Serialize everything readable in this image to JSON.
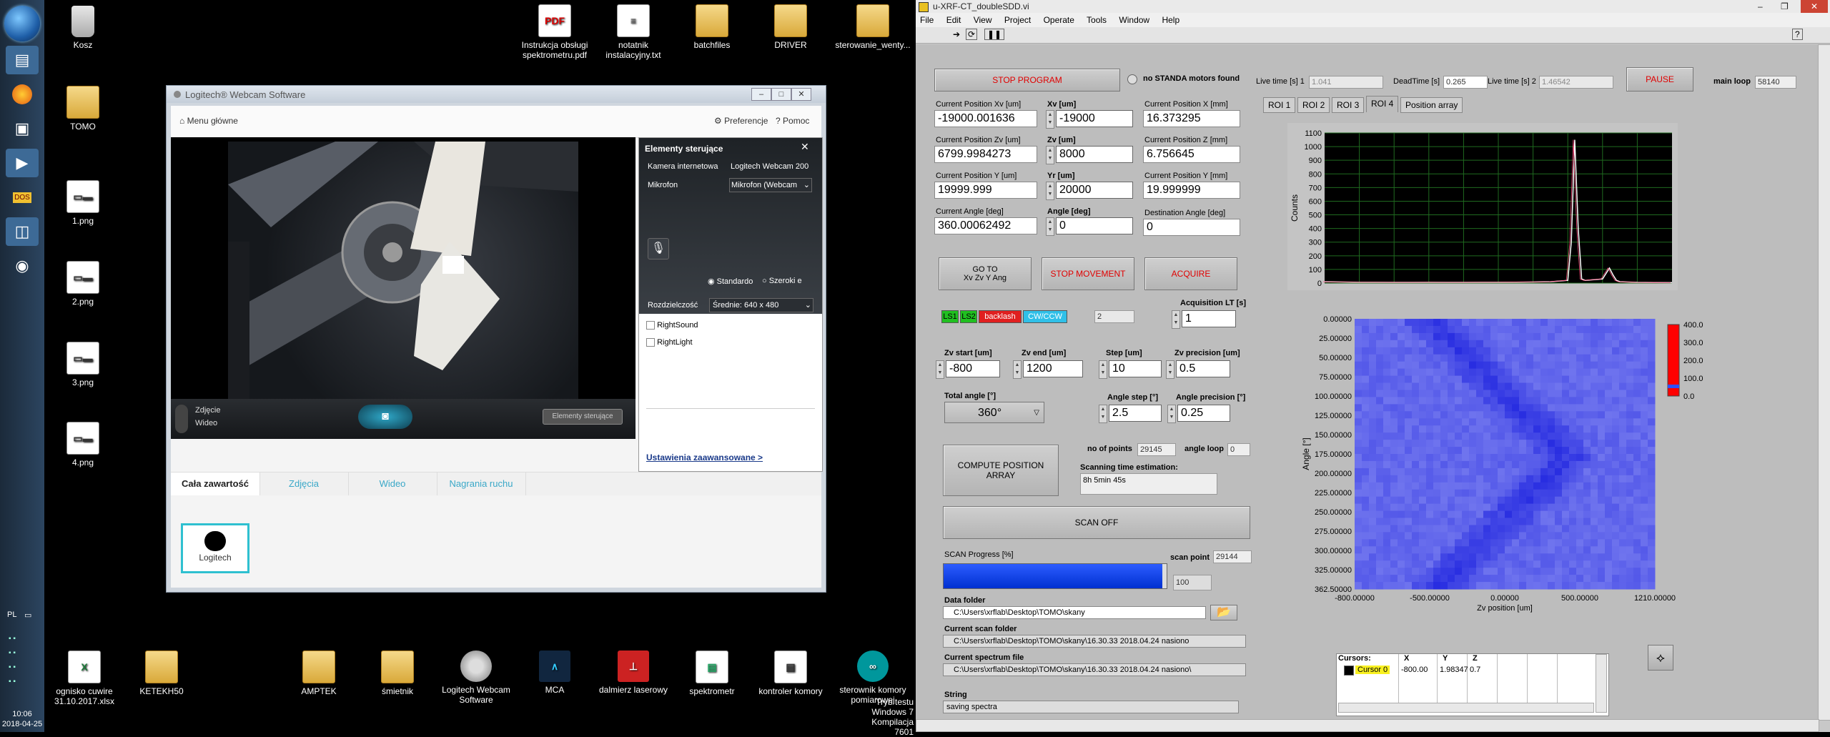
{
  "taskbar": {
    "lang": "PL",
    "time": "10:06",
    "date": "2018-04-25"
  },
  "desktop": {
    "icons_left": [
      {
        "label": "Kosz"
      },
      {
        "label": "TOMO"
      },
      {
        "label": "1.png"
      },
      {
        "label": "2.png"
      },
      {
        "label": "3.png"
      },
      {
        "label": "4.png"
      }
    ],
    "icons_top": [
      {
        "label": "Instrukcja obsługi spektrometru.pdf",
        "badge": "PDF"
      },
      {
        "label": "notatnik instalacyjny.txt"
      },
      {
        "label": "batchfiles"
      },
      {
        "label": "DRIVER"
      },
      {
        "label": "sterowanie_wenty..."
      }
    ],
    "icons_bottom": [
      {
        "label": "ognisko cuwire 31.10.2017.xlsx"
      },
      {
        "label": "KETEKH50"
      },
      {
        "label": "AMPTEK"
      },
      {
        "label": "śmietnik"
      },
      {
        "label": "Logitech Webcam Software"
      },
      {
        "label": "MCA"
      },
      {
        "label": "dalmierz laserowy"
      },
      {
        "label": "spektrometr"
      },
      {
        "label": "kontroler komory"
      },
      {
        "label": "sterownik komory pomiarowej"
      }
    ],
    "watermark": [
      "Tryb testu",
      "Windows 7",
      "Kompilacja 7601"
    ]
  },
  "logitech": {
    "title": "Logitech® Webcam Software",
    "nav_home": "Menu główne",
    "nav_prefs": "Preferencje",
    "nav_help": "Pomoc",
    "mode_photo": "Zdjęcie",
    "mode_video": "Wideo",
    "controls_button": "Elementy sterujące",
    "panel": {
      "title": "Elementy sterujące",
      "camera_label": "Kamera internetowa",
      "camera_value": "Logitech Webcam 200",
      "mic_label": "Mikrofon",
      "mic_value": "Mikrofon (Webcam",
      "radio_standard": "Standardo",
      "radio_wide": "Szeroki e",
      "res_label": "Rozdzielczość",
      "res_value": "Średnie: 640 x 480",
      "check1": "RightSound",
      "check2": "RightLight",
      "advanced": "Ustawienia zaawansowane >"
    },
    "tabs": [
      "Cała zawartość",
      "Zdjęcia",
      "Wideo",
      "Nagrania ruchu"
    ],
    "thumb_label": "Logitech"
  },
  "lv": {
    "title": "u-XRF-CT_doubleSDD.vi",
    "menu": [
      "File",
      "Edit",
      "View",
      "Project",
      "Operate",
      "Tools",
      "Window",
      "Help"
    ],
    "stop_program": "STOP PROGRAM",
    "no_standa": "no STANDA motors found",
    "live_time1_label": "Live time [s] 1",
    "live_time1": "1.041",
    "deadtime_label": "DeadTime [s]",
    "deadtime": "0.265",
    "live_time2_label": "Live time [s] 2",
    "live_time2": "1.46542",
    "pause": "PAUSE",
    "main_loop_label": "main loop",
    "main_loop": "58140",
    "tabs": [
      "ROI 1",
      "ROI 2",
      "ROI 3",
      "ROI 4",
      "Position array"
    ],
    "pos": {
      "cur_xv_label": "Current Position Xv [um]",
      "cur_xv": "-19000.001636",
      "xv_label": "Xv [um]",
      "xv": "-19000",
      "cur_x_label": "Current Position X [mm]",
      "cur_x": "16.373295",
      "cur_zv_label": "Current Position Zv [um]",
      "cur_zv": "6799.9984273",
      "zv_label": "Zv [um]",
      "zv": "8000",
      "cur_z_label": "Current Position Z [mm]",
      "cur_z": "6.756645",
      "cur_y_label": "Current Position Y [um]",
      "cur_y": "19999.999",
      "yr_label": "Yr [um]",
      "yr": "20000",
      "cur_ymm_label": "Current Position Y [mm]",
      "cur_ymm": "19.999999",
      "cur_angle_label": "Current Angle [deg]",
      "cur_angle": "360.00062492",
      "angle_label": "Angle [deg]",
      "angle": "0",
      "dest_angle_label": "Destination Angle [deg]",
      "dest_angle": "0"
    },
    "goto": "GO TO\nXv Zv Y Ang",
    "stop_movement": "STOP MOVEMENT",
    "acquire": "ACQUIRE",
    "ls1": "LS1",
    "ls2": "LS2",
    "backlash": "backlash",
    "cwccw": "CW/CCW",
    "small_val": "2",
    "acq_lt_label": "Acquisition LT [s]",
    "acq_lt": "1",
    "zv_start_label": "Zv start [um]",
    "zv_start": "-800",
    "zv_end_label": "Zv end [um]",
    "zv_end": "1200",
    "step_label": "Step [um]",
    "step": "10",
    "zv_prec_label": "Zv precision [um]",
    "zv_prec": "0.5",
    "total_angle_label": "Total angle [°]",
    "total_angle": "360°",
    "angle_step_label": "Angle step [°]",
    "angle_step": "2.5",
    "angle_prec_label": "Angle precision [°]",
    "angle_prec": "0.25",
    "no_points_label": "no of points",
    "no_points": "29145",
    "angle_loop_label": "angle loop",
    "angle_loop": "0",
    "compute": "COMPUTE POSITION\nARRAY",
    "scan_time_label": "Scanning time estimation:",
    "scan_time": "8h  5min  45s",
    "scan_off": "SCAN OFF",
    "scan_progress_label": "SCAN Progress [%]",
    "scan_point_label": "scan point",
    "scan_point": "29144",
    "progress_max": "100",
    "progress_fraction": 0.98,
    "data_folder_label": "Data folder",
    "data_folder": "C:\\Users\\xrflab\\Desktop\\TOMO\\skany",
    "scan_folder_label": "Current scan folder",
    "scan_folder": "C:\\Users\\xrflab\\Desktop\\TOMO\\skany\\16.30.33 2018.04.24 nasiono",
    "spectrum_file_label": "Current spectrum file",
    "spectrum_file": "C:\\Users\\xrflab\\Desktop\\TOMO\\skany\\16.30.33 2018.04.24 nasiono\\",
    "string_label": "String",
    "string_val": "saving spectra",
    "cursors": {
      "headers": [
        "Cursors:",
        "X",
        "Y",
        "Z"
      ],
      "row": [
        "Cursor 0",
        "-800.00",
        "1.98347",
        "0.7"
      ]
    },
    "colorbar_ticks": [
      "400.0",
      "300.0",
      "200.0",
      "100.0",
      "0.0"
    ]
  },
  "chart_data": [
    {
      "type": "line",
      "title": "",
      "xlabel": "",
      "ylabel": "Counts",
      "ylim": [
        0,
        1100
      ],
      "yticks": [
        "1100",
        "1000",
        "900",
        "800",
        "700",
        "600",
        "500",
        "400",
        "300",
        "200",
        "100",
        "0"
      ],
      "x": [
        0,
        0.05,
        0.1,
        0.15,
        0.2,
        0.25,
        0.3,
        0.35,
        0.4,
        0.45,
        0.5,
        0.55,
        0.6,
        0.65,
        0.7,
        0.71,
        0.72,
        0.73,
        0.74,
        0.75,
        0.8,
        0.82,
        0.83,
        0.84,
        0.85,
        0.9,
        0.95,
        1.0
      ],
      "series": [
        {
          "values": [
            10,
            8,
            6,
            6,
            5,
            5,
            6,
            5,
            5,
            6,
            6,
            7,
            8,
            10,
            20,
            300,
            1050,
            400,
            30,
            20,
            30,
            110,
            60,
            20,
            10,
            5,
            4,
            3
          ]
        }
      ],
      "grid": true
    },
    {
      "type": "heatmap",
      "title": "",
      "xlabel": "Zv position [um]",
      "ylabel": "Angle [°]",
      "xticks": [
        "-800.00000",
        "-500.00000",
        "0.00000",
        "500.00000",
        "1210.00000"
      ],
      "yticks": [
        "0.00000",
        "25.00000",
        "50.00000",
        "75.00000",
        "100.00000",
        "125.00000",
        "150.00000",
        "175.00000",
        "200.00000",
        "225.00000",
        "250.00000",
        "275.00000",
        "300.00000",
        "325.00000",
        "362.50000"
      ],
      "xlim": [
        -800,
        1210
      ],
      "ylim": [
        0,
        362.5
      ],
      "zlim": [
        0,
        400
      ]
    }
  ]
}
